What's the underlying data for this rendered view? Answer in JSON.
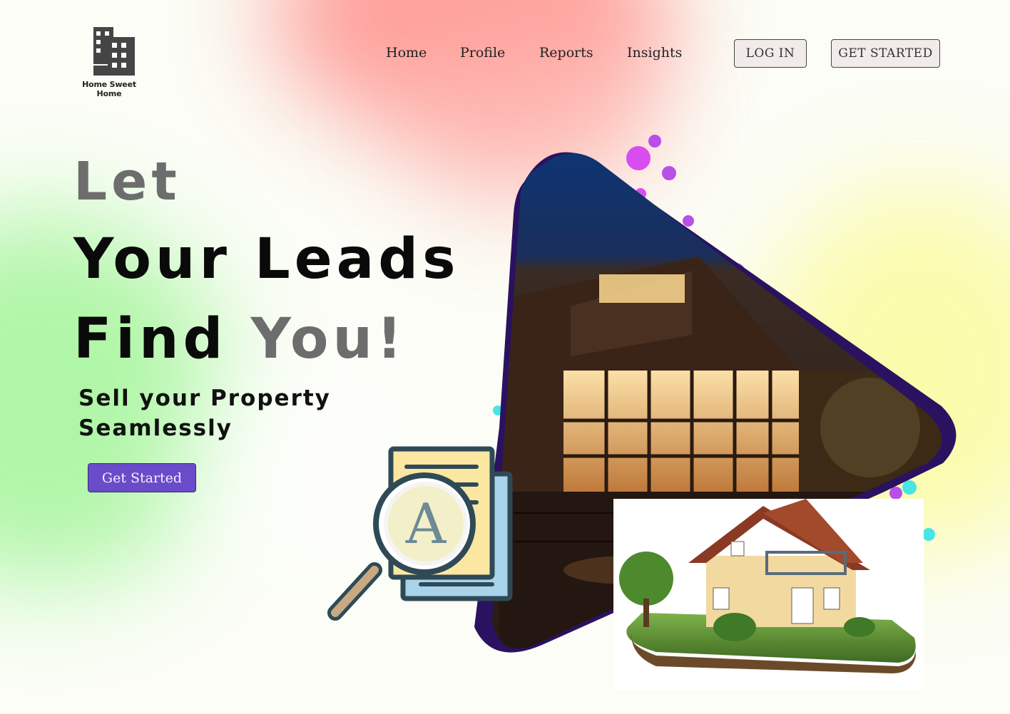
{
  "brand": {
    "name": "Home Sweet Home",
    "logo_icon": "building-icon"
  },
  "nav": {
    "items": [
      "Home",
      "Profile",
      "Reports",
      "Insights"
    ]
  },
  "auth": {
    "login_label": "LOG IN",
    "get_started_label": "GET STARTED"
  },
  "hero": {
    "line1": "Let",
    "line2": "Your Leads",
    "line3_a": "Find",
    "line3_b": "You!",
    "subtitle_1": "Sell your Property",
    "subtitle_2": "Seamlessly",
    "cta_label": "Get Started",
    "illustration_icon": "document-search-icon",
    "illustration_letter": "A"
  },
  "colors": {
    "accent": "#6a4bc9",
    "headline_dark": "#0a0a0a",
    "headline_grey": "#6d6d6d",
    "triangle_border": "#2a1260"
  }
}
